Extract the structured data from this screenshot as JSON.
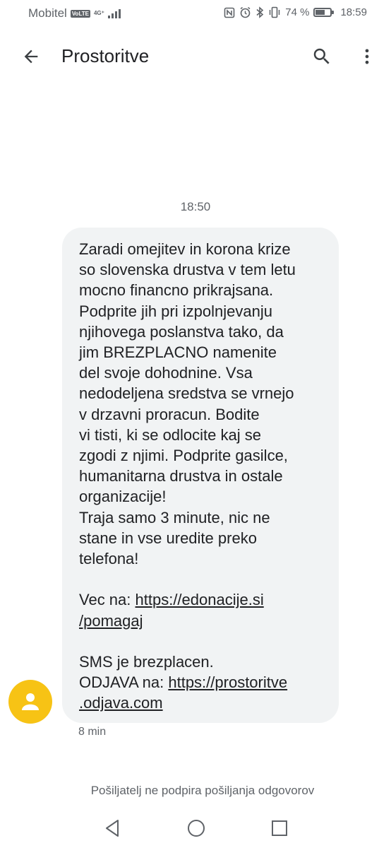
{
  "status_bar": {
    "carrier": "Mobitel",
    "volte": "VoLTE",
    "network": "4G⁺",
    "battery_text": "74 %",
    "battery_level": 0.74,
    "time": "18:59",
    "icons": [
      "nfc-icon",
      "alarm-icon",
      "bluetooth-icon",
      "vibrate-icon",
      "battery-icon"
    ]
  },
  "app_bar": {
    "title": "Prostoritve",
    "icons": [
      "arrow-back-icon",
      "search-icon",
      "more-vert-icon"
    ]
  },
  "conversation": {
    "date_header": "18:50",
    "message": {
      "text": "Zaradi omejitev in korona krize\nso slovenska drustva v tem letu\nmocno financno prikrajsana.\nPodprite jih pri izpolnjevanju\nnjihovega poslanstva tako, da\njim BREZPLACNO namenite\ndel svoje dohodnine. Vsa\nnedodeljena sredstva se vrnejo\nv drzavni proracun. Bodite\nvi tisti, ki se odlocite kaj se\nzgodi z njimi. Podprite gasilce,\nhumanitarna drustva in ostale\norganizacije!\nTraja samo 3 minute, nic ne\nstane in vse uredite preko\ntelefona!",
      "donation_prefix": "Vec na: ",
      "donation_link_part1": "https://edonacije.si",
      "donation_link_part2": "/pomagaj",
      "sms_free": "SMS je brezplacen.",
      "unsubscribe_prefix": "ODJAVA na: ",
      "unsubscribe_link_part1": "https://prostoritve",
      "unsubscribe_link_part2": ".odjava.com",
      "timestamp": "8 min"
    },
    "avatar_color": "#f7c315",
    "bubble_color": "#f1f3f4"
  },
  "footer": {
    "no_reply_text": "Pošiljatelj ne podpira pošiljanja odgovorov"
  },
  "nav_bar": {
    "icons": [
      "nav-back-icon",
      "nav-home-icon",
      "nav-recents-icon"
    ]
  }
}
